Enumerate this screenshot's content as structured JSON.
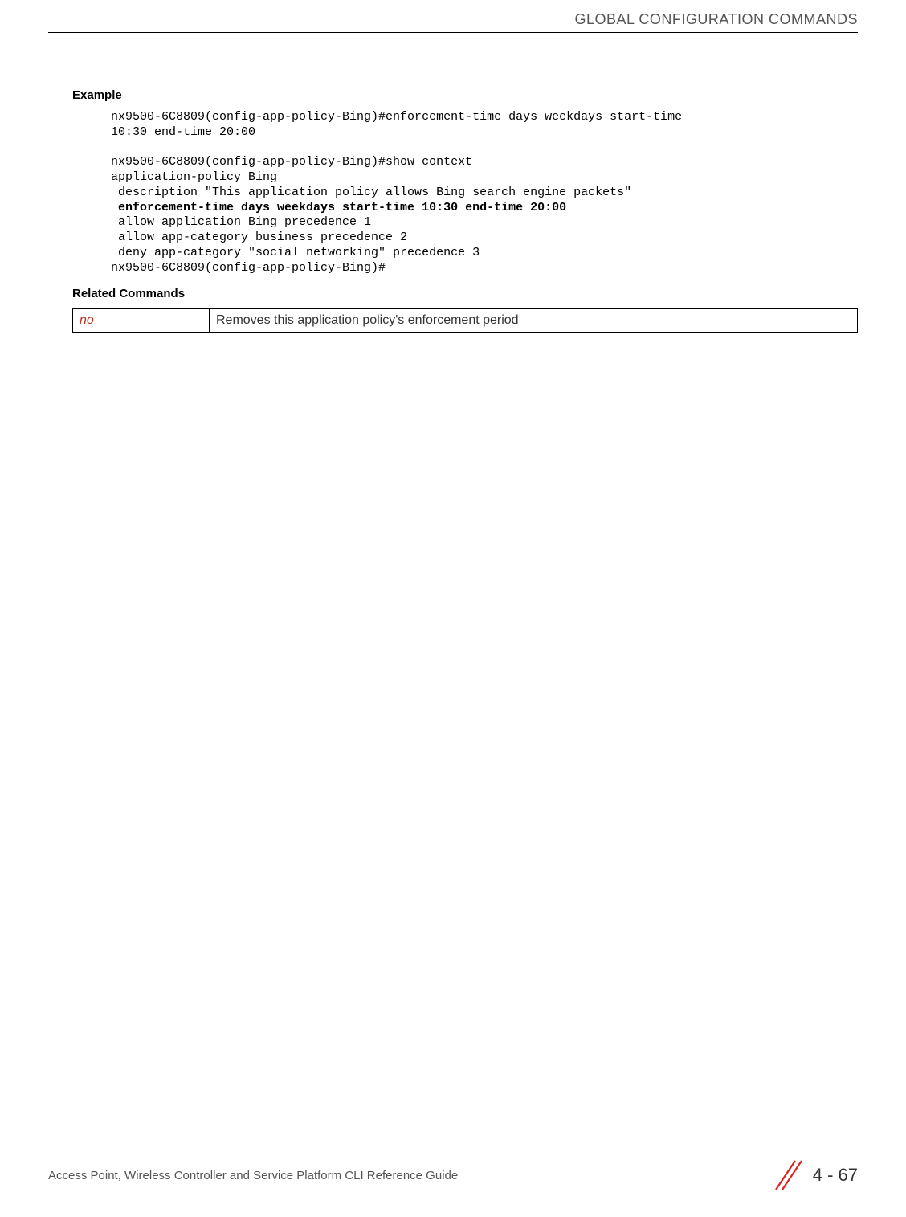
{
  "header": {
    "title": "GLOBAL CONFIGURATION COMMANDS"
  },
  "sections": {
    "example_heading": "Example",
    "related_heading": "Related Commands"
  },
  "code": {
    "line1": "nx9500-6C8809(config-app-policy-Bing)#enforcement-time days weekdays start-time ",
    "line2": "10:30 end-time 20:00",
    "blank1": "",
    "line3": "nx9500-6C8809(config-app-policy-Bing)#show context",
    "line4": "application-policy Bing",
    "line5": " description \"This application policy allows Bing search engine packets\"",
    "line6_bold": " enforcement-time days weekdays start-time 10:30 end-time 20:00",
    "line7": " allow application Bing precedence 1",
    "line8": " allow app-category business precedence 2",
    "line9": " deny app-category \"social networking\" precedence 3",
    "line10": "nx9500-6C8809(config-app-policy-Bing)#"
  },
  "related_table": {
    "cmd": "no",
    "desc": "Removes this application policy's enforcement period"
  },
  "footer": {
    "text": "Access Point, Wireless Controller and Service Platform CLI Reference Guide",
    "page": "4 - 67"
  }
}
